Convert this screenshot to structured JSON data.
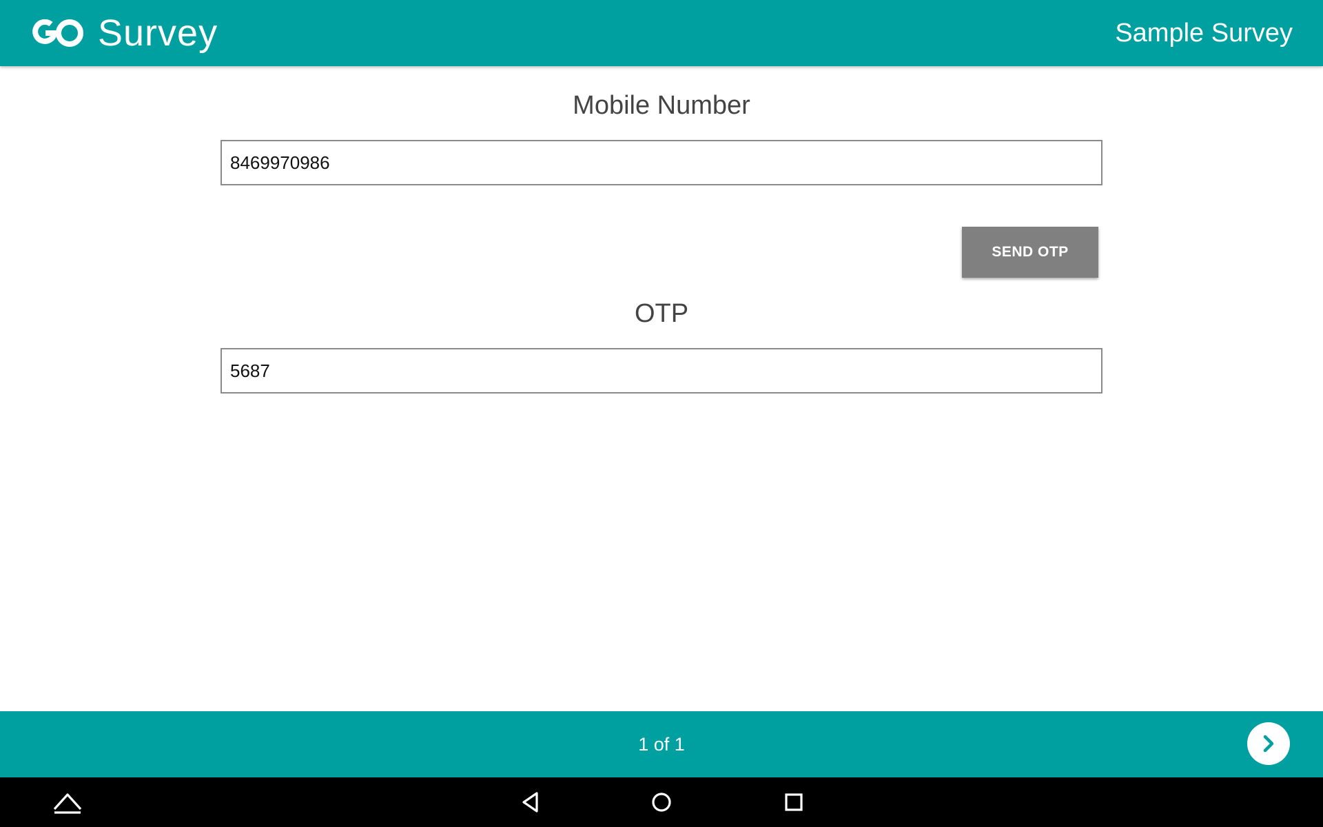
{
  "header": {
    "logo_mark": "GO",
    "logo_text": "Survey",
    "survey_title": "Sample Survey",
    "background_color": "#00A0A0"
  },
  "form": {
    "mobile_label": "Mobile Number",
    "mobile_value": "8469970986",
    "send_otp_label": "SEND OTP",
    "otp_label": "OTP",
    "otp_value": "5687"
  },
  "footer": {
    "page_indicator": "1 of 1",
    "next_icon": "chevron-right-icon"
  },
  "system_nav": {
    "icons": [
      "keyboard-hide-icon",
      "back-icon",
      "home-icon",
      "recents-icon"
    ]
  }
}
